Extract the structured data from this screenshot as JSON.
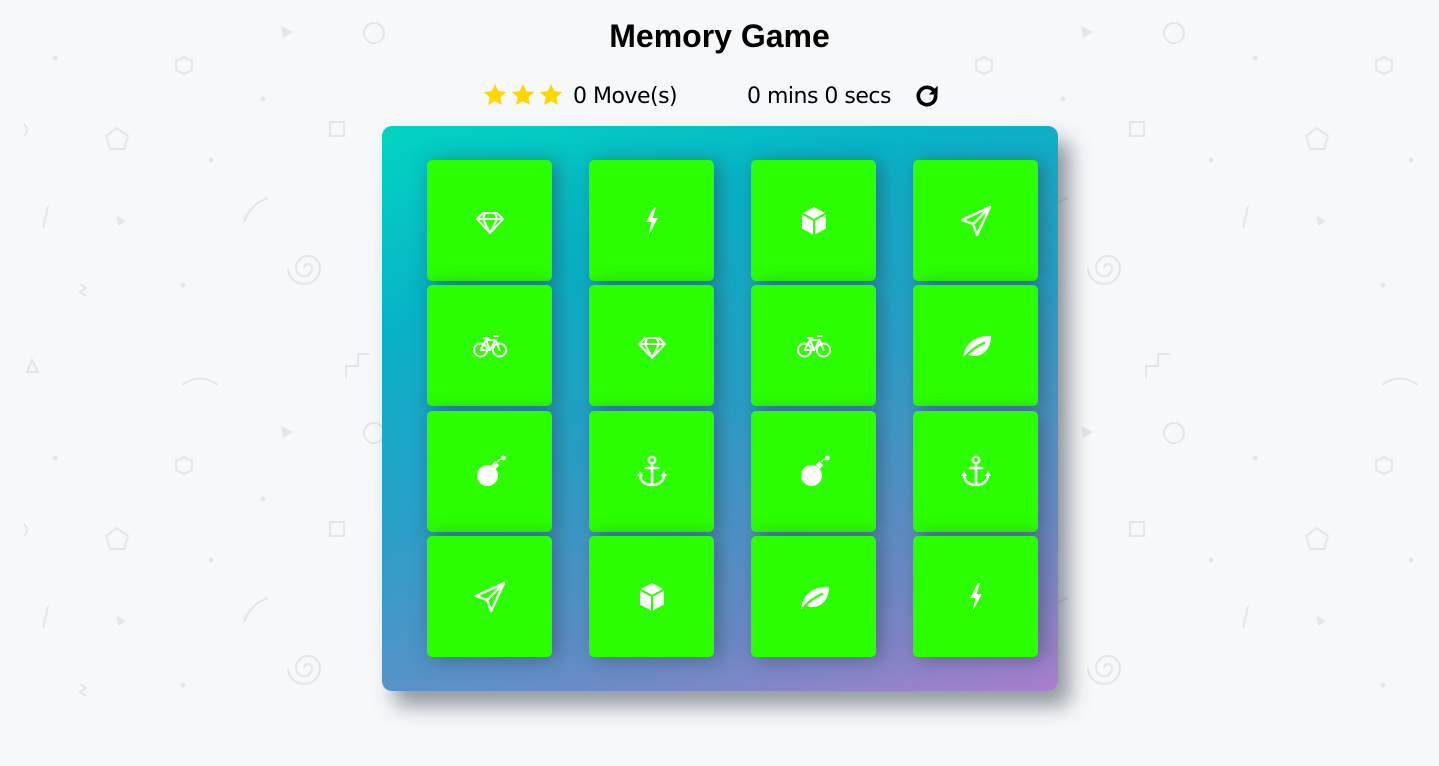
{
  "header": {
    "title": "Memory Game"
  },
  "score_panel": {
    "stars": [
      "star-icon",
      "star-icon",
      "star-icon"
    ],
    "star_color": "#ffd700",
    "moves_text": "0 Move(s)",
    "timer_text": "0 mins 0 secs",
    "restart_icon": "restart-icon"
  },
  "deck": {
    "card_color": "#2bff00",
    "gradient_start": "#02d4c2",
    "gradient_end": "#aa7ecd",
    "cards": [
      {
        "icon": "diamond"
      },
      {
        "icon": "bolt"
      },
      {
        "icon": "cube"
      },
      {
        "icon": "paper-plane"
      },
      {
        "icon": "bicycle"
      },
      {
        "icon": "diamond"
      },
      {
        "icon": "bicycle"
      },
      {
        "icon": "leaf"
      },
      {
        "icon": "bomb"
      },
      {
        "icon": "anchor"
      },
      {
        "icon": "bomb"
      },
      {
        "icon": "anchor"
      },
      {
        "icon": "paper-plane"
      },
      {
        "icon": "cube"
      },
      {
        "icon": "leaf"
      },
      {
        "icon": "bolt"
      }
    ]
  }
}
